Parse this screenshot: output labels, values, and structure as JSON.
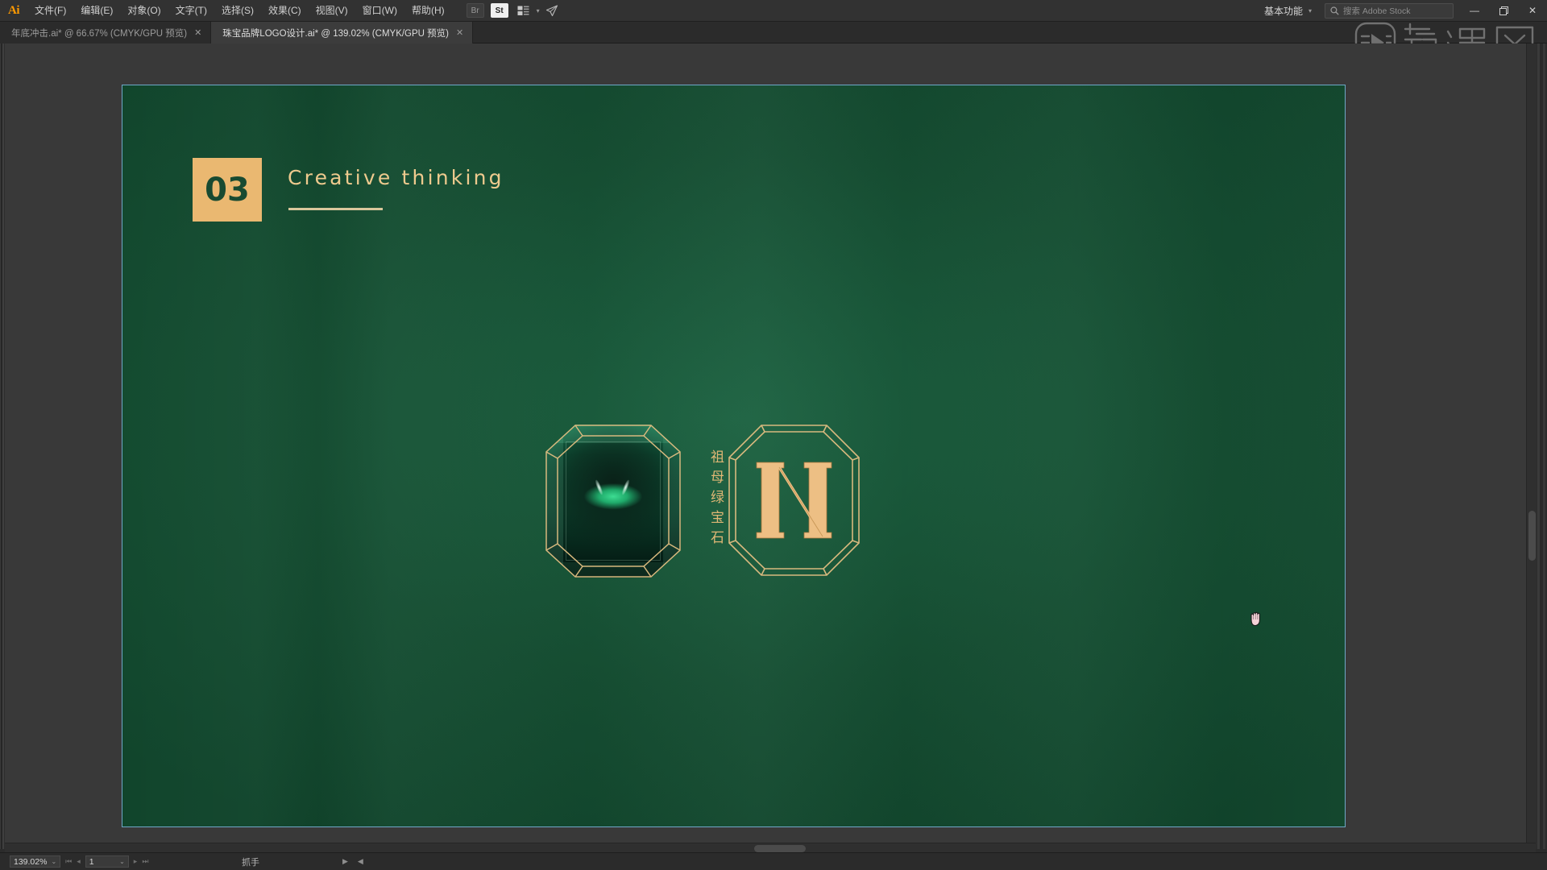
{
  "app": {
    "name": "Adobe Illustrator",
    "logo_text": "Ai"
  },
  "menubar": {
    "items": [
      {
        "label": "文件(F)",
        "name": "menu-file"
      },
      {
        "label": "编辑(E)",
        "name": "menu-edit"
      },
      {
        "label": "对象(O)",
        "name": "menu-object"
      },
      {
        "label": "文字(T)",
        "name": "menu-type"
      },
      {
        "label": "选择(S)",
        "name": "menu-select"
      },
      {
        "label": "效果(C)",
        "name": "menu-effect"
      },
      {
        "label": "视图(V)",
        "name": "menu-view"
      },
      {
        "label": "窗口(W)",
        "name": "menu-window"
      },
      {
        "label": "帮助(H)",
        "name": "menu-help"
      }
    ],
    "toolbar_icons": [
      {
        "name": "bridge-icon",
        "glyph": "Br"
      },
      {
        "name": "stock-icon",
        "glyph": "St"
      },
      {
        "name": "arrange-documents-icon",
        "glyph": "▤"
      },
      {
        "name": "discover-icon",
        "glyph": "➤"
      }
    ],
    "workspace": {
      "label": "基本功能",
      "caret": "⌄"
    },
    "search": {
      "placeholder": "搜索 Adobe Stock",
      "icon": "search-icon"
    },
    "window_controls": {
      "minimize": "—",
      "restore": "❐",
      "close": "✕"
    }
  },
  "tabs": [
    {
      "label": "年底冲击.ai* @ 66.67% (CMYK/GPU 预览)",
      "active": false,
      "close": "✕"
    },
    {
      "label": "珠宝品牌LOGO设计.ai* @ 139.02% (CMYK/GPU 预览)",
      "active": true,
      "close": "✕"
    }
  ],
  "watermark": {
    "text": "虎课网",
    "name": "huke-watermark"
  },
  "artboard": {
    "background_color": "#165034",
    "selection_color": "#6fa8c8",
    "section": {
      "number": "03",
      "title": "Creative thinking",
      "badge_color": "#eab871",
      "title_color": "#eeca8e"
    },
    "gemstone": {
      "name": "emerald-gemstone",
      "outline_color": "#d8b97e"
    },
    "gem_label": {
      "chars": [
        "祖",
        "母",
        "绿",
        "宝",
        "石"
      ],
      "color": "#e0b775"
    },
    "logo": {
      "name": "n-monogram-logo",
      "letter": "N",
      "color": "#edbf84",
      "frame_color": "#d8b97e"
    }
  },
  "cursor": {
    "name": "hand-tool-cursor"
  },
  "statusbar": {
    "zoom": "139.02%",
    "zoom_caret": "⌄",
    "nav_first": "⏮",
    "nav_prev": "◂",
    "page": "1",
    "page_caret": "⌄",
    "nav_next": "▸",
    "nav_last": "⏭",
    "tool": "抓手",
    "arrow_right": "▶",
    "arrow_left": "◀"
  }
}
